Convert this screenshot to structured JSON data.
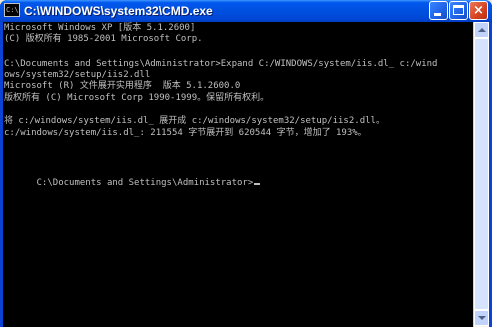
{
  "window": {
    "title": "C:\\WINDOWS\\system32\\CMD.exe",
    "icon": "C:\\"
  },
  "controls": {
    "minimize": "minimize-icon",
    "maximize": "maximize-icon",
    "close": "×"
  },
  "console": {
    "lines": [
      "Microsoft Windows XP [版本 5.1.2600]",
      "(C) 版权所有 1985-2001 Microsoft Corp.",
      "",
      "C:\\Documents and Settings\\Administrator>Expand C:/WINDOWS/system/iis.dl_ c:/wind",
      "ows/system32/setup/iis2.dll",
      "Microsoft (R) 文件展开实用程序  版本 5.1.2600.0",
      "版权所有 (C) Microsoft Corp 1990-1999。保留所有权利。",
      "",
      "将 c:/windows/system/iis.dl_ 展开成 c:/windows/system32/setup/iis2.dll。",
      "c:/windows/system/iis.dl_: 211554 字节展开到 620544 字节，增加了 193%。",
      "",
      "",
      "C:\\Documents and Settings\\Administrator>"
    ]
  }
}
